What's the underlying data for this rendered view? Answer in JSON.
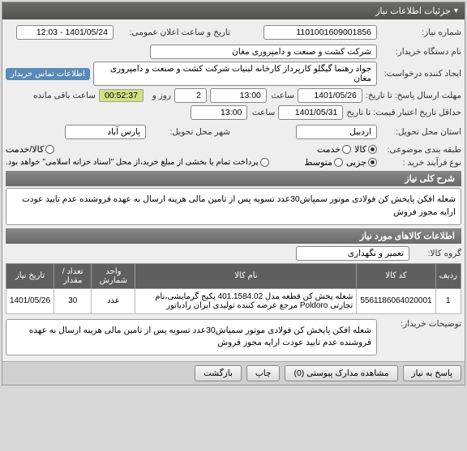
{
  "panel": {
    "title": "جزئیات اطلاعات نیاز"
  },
  "f": {
    "need_no_lbl": "شماره نیاز:",
    "need_no": "1101001609001856",
    "ann_lbl": "تاریخ و ساعت اعلان عمومی:",
    "ann": "1401/05/24 - 12:03",
    "buyer_lbl": "نام دستگاه خریدار:",
    "buyer": "شرکت کشت و صنعت و دامپروری مغان",
    "creator_lbl": "ایجاد کننده درخواست:",
    "creator": "جواد رهنما گیگلو کارپرداز کارخانه لبنیات شرکت کشت و صنعت و دامپروری مغان",
    "contact": "اطلاعات تماس خریدار",
    "deadline_lbl": "مهلت ارسال پاسخ: تا تاریخ:",
    "deadline_date": "1401/05/26",
    "time_lbl": "ساعت",
    "deadline_time": "13:00",
    "day_lbl": "روز و",
    "days": "2",
    "remain_lbl": "ساعت باقی مانده",
    "remain": "00:52:37",
    "valid_lbl": "حداقل تاریخ اعتبار قیمت: تا تاریخ",
    "valid_date": "1401/05/31",
    "valid_time": "13:00",
    "prov_lbl": "استان محل تحویل:",
    "prov": "اردبیل",
    "city_lbl": "شهر محل تحویل:",
    "city": "پارس آباد",
    "cat_lbl": "طبقه بندی موضوعی:",
    "goods": "کالا",
    "service": "خدمت",
    "proc_lbl": "نوع فرآیند خرید :",
    "minor": "جزیی",
    "medium": "متوسط",
    "pay_note": "پرداخت تمام یا بخشی از مبلغ خرید،از محل \"اسناد خزانه اسلامی\" خواهد بود."
  },
  "s1": {
    "title": "شرح کلی نیاز"
  },
  "desc": "شعله افکن پایخش کن فولادی موتور سمپاش30عدد تسویه پس از تامین مالی هزینه ارسال به عهده فروشنده عدم تایید عودت ارایه مجوز فروش",
  "s2": {
    "title": "اطلاعات کالاهای مورد نیاز"
  },
  "grp_lbl": "گروه کالا:",
  "grp": "تعمیر و نگهداری",
  "tbl": {
    "h": {
      "row": "ردیف",
      "code": "کد کالا",
      "name": "نام کالا",
      "unit": "واحد شمارش",
      "qty": "تعداد / مقدار",
      "date": "تاریخ نیاز"
    },
    "r": [
      {
        "row": "1",
        "code": "5561186064020001",
        "name": "شعله پخش کن قطعه مدل 401.1584.02 پکیج گرمایشی،نام تجارتی Poldoro مرجع عرضه کننده تولیدی ایران رادیاتور",
        "unit": "عدد",
        "qty": "30",
        "date": "1401/05/26"
      }
    ]
  },
  "bn_lbl": "توضیحات خریدار:",
  "bn": "شعله افکن پایخش کن فولادی موتور سمپاش30عدد تسویه پس از تامین مالی هزینه ارسال به عهده فروشنده عدم تایید عودت ارایه مجوز فروش",
  "btns": {
    "reply": "پاسخ به نیاز",
    "docs": "مشاهده مدارک پیوستی (0)",
    "print": "چاپ",
    "back": "بازگشت"
  }
}
